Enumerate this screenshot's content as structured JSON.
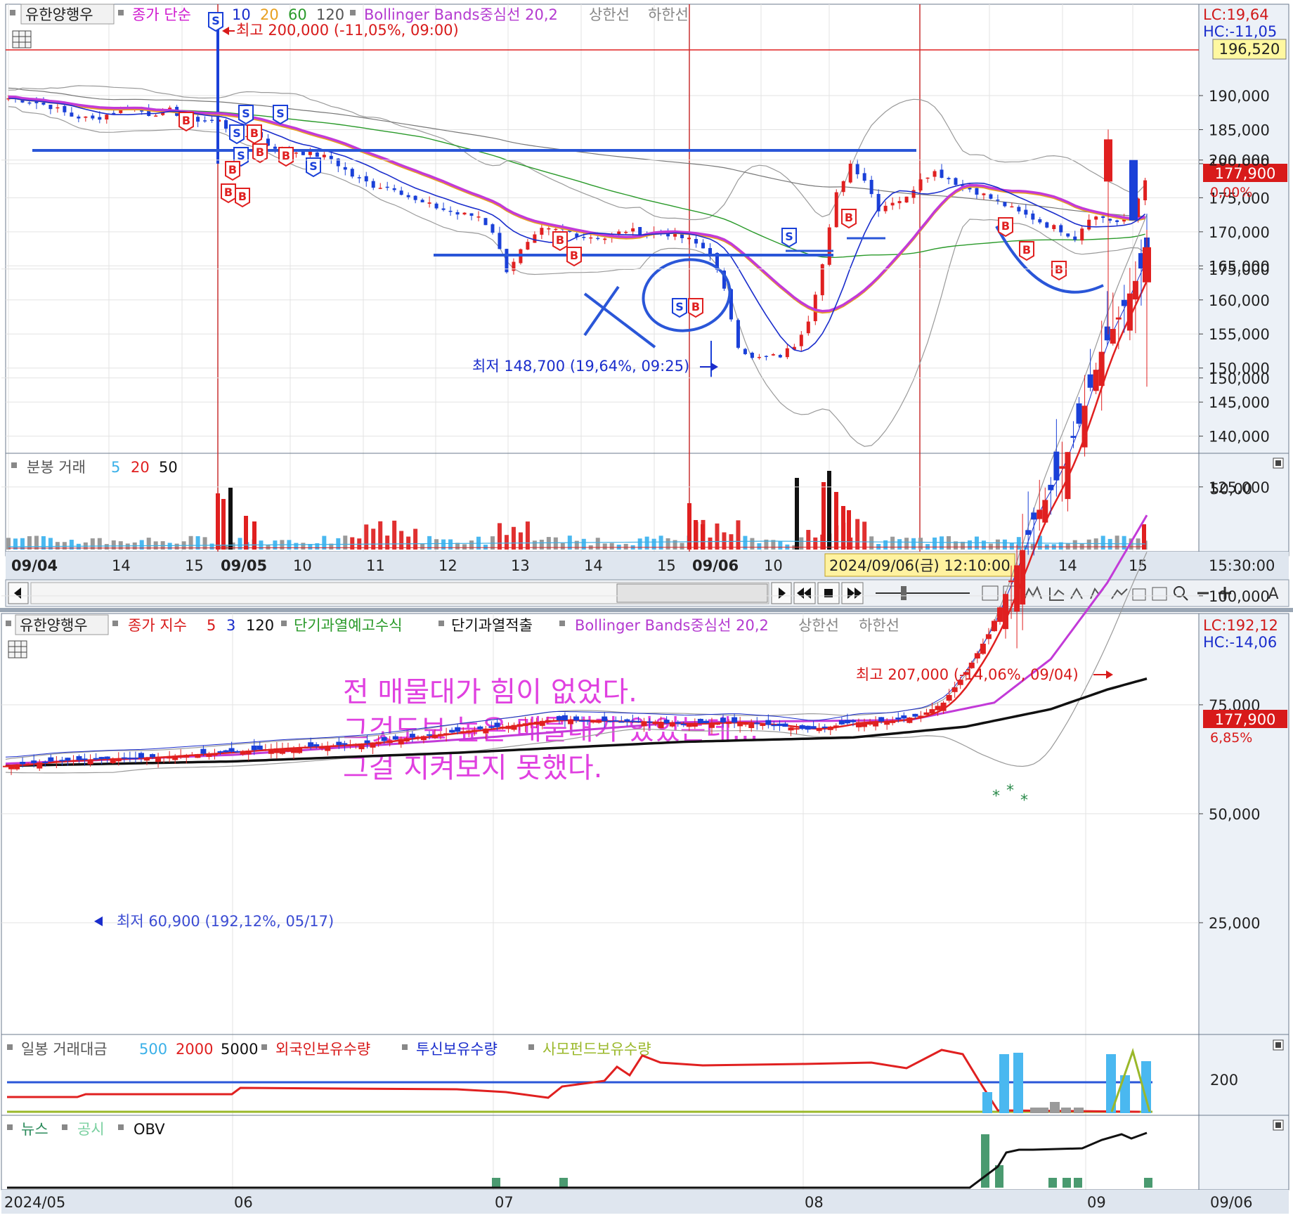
{
  "top": {
    "legend": {
      "stock": "유한양행우",
      "price_type": "종가 단순",
      "ma": [
        "10",
        "20",
        "60",
        "120"
      ],
      "ma_colors": [
        "#1a2dcc",
        "#e8a020",
        "#2a9a2a",
        "#555555"
      ],
      "bb": "Bollinger Bands중심선 20,2",
      "upper": "상한선",
      "lower": "하한선"
    },
    "lc": "LC:19,64",
    "hc": "HC:-11,05",
    "hline_price": "196,520",
    "current_price": "177,900",
    "current_change": "0,00%",
    "high_annotation": "최고 200,000 (-11,05%, 09:00)",
    "low_annotation": "최저 148,700 (19,64%, 09:25)",
    "y_ticks": [
      "190,000",
      "185,000",
      "180,000",
      "175,000",
      "170,000",
      "165,000",
      "160,000",
      "155,000",
      "150,000",
      "145,000",
      "140,000"
    ],
    "volume_legend": {
      "label": "분봉 거래",
      "p1": "5",
      "p2": "20",
      "p3": "50"
    },
    "volume_tick": "50,00",
    "x_labels": [
      "09/04",
      "14",
      "15",
      "09/05",
      "10",
      "11",
      "12",
      "13",
      "14",
      "15",
      "09/06",
      "10",
      "2024/09/06(금) 12:10:00",
      "14",
      "15"
    ],
    "time_corner": "15:30:00"
  },
  "bottom": {
    "legend": {
      "stock": "유한양행우",
      "price_type": "종가 지수",
      "p1": "5",
      "p2": "3",
      "p3": "120",
      "ind1": "단기과열예고수식",
      "ind2": "단기과열적출",
      "bb": "Bollinger Bands중심선 20,2",
      "upper": "상한선",
      "lower": "하한선"
    },
    "lc": "LC:192,12",
    "hc": "HC:-14,06",
    "current_price": "177,900",
    "current_change": "6,85%",
    "high_annotation": "최고 207,000 (-14,06%, 09/04)",
    "low_annotation": "최저 60,900 (192,12%, 05/17)",
    "note_lines": [
      "전 매물대가 힘이 없었다.",
      "그것도보 높은 매물대가 있었는데...",
      "그걸 지켜보지 못했다."
    ],
    "y_ticks": [
      "200,000",
      "175,000",
      "150,000",
      "125,000",
      "100,000",
      "75,000",
      "50,000",
      "25,000"
    ],
    "amount_legend": {
      "label": "일봉 거래대금",
      "p1": "500",
      "p2": "2000",
      "p3": "5000",
      "foreign": "외국인보유수량",
      "trust": "투신보유수량",
      "private": "사모펀드보유수량"
    },
    "amount_tick": "200",
    "news_legend": {
      "news": "뉴스",
      "disclosure": "공시",
      "obv": "OBV"
    },
    "x_labels": [
      "2024/05",
      "06",
      "07",
      "08",
      "09"
    ],
    "date_corner": "09/06"
  },
  "chart_data": [
    {
      "type": "candlestick",
      "title": "유한양행우 분봉",
      "x": [
        "09/04",
        "09/05",
        "09/06"
      ],
      "high": 200000,
      "low": 148700,
      "last": 177900,
      "ylim": [
        138000,
        203000
      ],
      "horizontal_line": 196520,
      "support_levels": [
        181400,
        165700
      ],
      "close_path": [
        [
          0,
          189600
        ],
        [
          3,
          189200
        ],
        [
          6,
          188400
        ],
        [
          9,
          187000
        ],
        [
          12,
          186500
        ],
        [
          14,
          187200
        ],
        [
          17,
          188400
        ],
        [
          20,
          187300
        ],
        [
          23,
          187800
        ],
        [
          26,
          186500
        ],
        [
          30,
          186300
        ],
        [
          33,
          183400
        ],
        [
          35,
          184800
        ],
        [
          37,
          182800
        ],
        [
          40,
          181900
        ],
        [
          43,
          181500
        ],
        [
          46,
          180700
        ],
        [
          49,
          178200
        ],
        [
          52,
          176800
        ],
        [
          55,
          176500
        ],
        [
          58,
          174500
        ],
        [
          61,
          173600
        ],
        [
          64,
          172600
        ],
        [
          67,
          172300
        ],
        [
          69,
          170100
        ],
        [
          71,
          164400
        ],
        [
          73,
          167200
        ],
        [
          76,
          170200
        ],
        [
          79,
          170200
        ],
        [
          82,
          169400
        ],
        [
          85,
          169100
        ],
        [
          88,
          170200
        ],
        [
          91,
          169900
        ],
        [
          94,
          169700
        ],
        [
          97,
          168800
        ],
        [
          100,
          167000
        ],
        [
          102,
          161300
        ],
        [
          104,
          153400
        ],
        [
          106,
          151300
        ],
        [
          108,
          151600
        ],
        [
          110,
          151800
        ],
        [
          112,
          153400
        ],
        [
          114,
          157200
        ],
        [
          116,
          165200
        ],
        [
          118,
          175500
        ],
        [
          120,
          180000
        ],
        [
          122,
          177700
        ],
        [
          124,
          173400
        ],
        [
          126,
          174500
        ],
        [
          128,
          174900
        ],
        [
          130,
          178000
        ],
        [
          132,
          178800
        ],
        [
          134,
          177800
        ],
        [
          136,
          176700
        ],
        [
          138,
          175900
        ],
        [
          140,
          174900
        ],
        [
          142,
          173900
        ],
        [
          144,
          172800
        ],
        [
          146,
          172000
        ],
        [
          148,
          171000
        ],
        [
          150,
          170300
        ],
        [
          152,
          169100
        ],
        [
          154,
          172200
        ],
        [
          156,
          172100
        ],
        [
          158,
          171400
        ],
        [
          160,
          172000
        ],
        [
          162,
          177900
        ]
      ],
      "volume": {
        "spikes_at": [
          "09/05 09:00",
          "09/06 09:00",
          "09/06 11:00"
        ]
      }
    },
    {
      "type": "candlestick",
      "title": "유한양행우 일봉",
      "x": [
        "2024/05",
        "06",
        "07",
        "08",
        "09"
      ],
      "high": 207000,
      "low": 60900,
      "last": 177900,
      "ylim": [
        0,
        215000
      ],
      "close_path": [
        [
          0,
          61000
        ],
        [
          8,
          62000
        ],
        [
          16,
          62500
        ],
        [
          24,
          62800
        ],
        [
          32,
          63500
        ],
        [
          40,
          64200
        ],
        [
          48,
          65000
        ],
        [
          56,
          65500
        ],
        [
          64,
          66200
        ],
        [
          72,
          67500
        ],
        [
          80,
          68800
        ],
        [
          88,
          70000
        ],
        [
          96,
          71500
        ],
        [
          104,
          71300
        ],
        [
          112,
          71000
        ],
        [
          120,
          70600
        ],
        [
          128,
          71000
        ],
        [
          136,
          70300
        ],
        [
          142,
          69300
        ],
        [
          146,
          70000
        ],
        [
          150,
          71000
        ],
        [
          156,
          71200
        ],
        [
          162,
          72500
        ],
        [
          166,
          75500
        ],
        [
          170,
          82500
        ],
        [
          174,
          91200
        ],
        [
          178,
          103500
        ],
        [
          182,
          117500
        ],
        [
          186,
          126500
        ],
        [
          190,
          139500
        ],
        [
          194,
          156000
        ],
        [
          198,
          166500
        ],
        [
          202,
          178000
        ]
      ],
      "ma_long_path": [
        [
          0,
          61000
        ],
        [
          40,
          62000
        ],
        [
          80,
          64000
        ],
        [
          120,
          66500
        ],
        [
          150,
          67500
        ],
        [
          170,
          70000
        ],
        [
          185,
          74000
        ],
        [
          195,
          78500
        ],
        [
          202,
          81000
        ]
      ],
      "bb_mid_path": [
        [
          0,
          61500
        ],
        [
          40,
          63500
        ],
        [
          80,
          67000
        ],
        [
          120,
          71000
        ],
        [
          160,
          71500
        ],
        [
          175,
          75500
        ],
        [
          185,
          85500
        ],
        [
          195,
          103000
        ],
        [
          202,
          118500
        ]
      ]
    }
  ]
}
